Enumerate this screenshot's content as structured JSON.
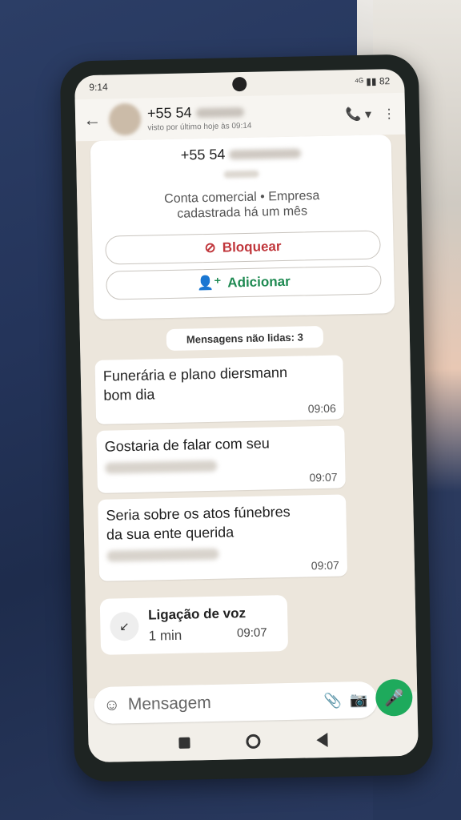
{
  "status": {
    "time": "9:14",
    "indicator": "⊙ •••",
    "right": "⁴ᴳ ▮▮ 82"
  },
  "header": {
    "back_icon": "←",
    "name": "+55 54",
    "subtitle": "visto por último hoje às 09:14",
    "call_icon": "📞 ▾",
    "menu_icon": "⋮"
  },
  "profile_card": {
    "number": "+55 54",
    "description_line1": "Conta comercial • Empresa",
    "description_line2": "cadastrada há um mês",
    "block_label": "Bloquear",
    "add_label": "Adicionar"
  },
  "unread_label": "Mensagens não lidas: 3",
  "messages": [
    {
      "line1": "Funerária e plano diersmann",
      "line2": "bom dia",
      "time": "09:06"
    },
    {
      "line1": "Gostaria de falar com seu",
      "time": "09:07"
    },
    {
      "line1": "Seria sobre os atos fúnebres",
      "line2": "da sua ente querida",
      "time": "09:07"
    }
  ],
  "call": {
    "title": "Ligação de voz",
    "duration": "1 min",
    "time": "09:07"
  },
  "input": {
    "placeholder": "Mensagem"
  },
  "colors": {
    "accent_green": "#1eaa5c",
    "block_red": "#c0363b"
  }
}
